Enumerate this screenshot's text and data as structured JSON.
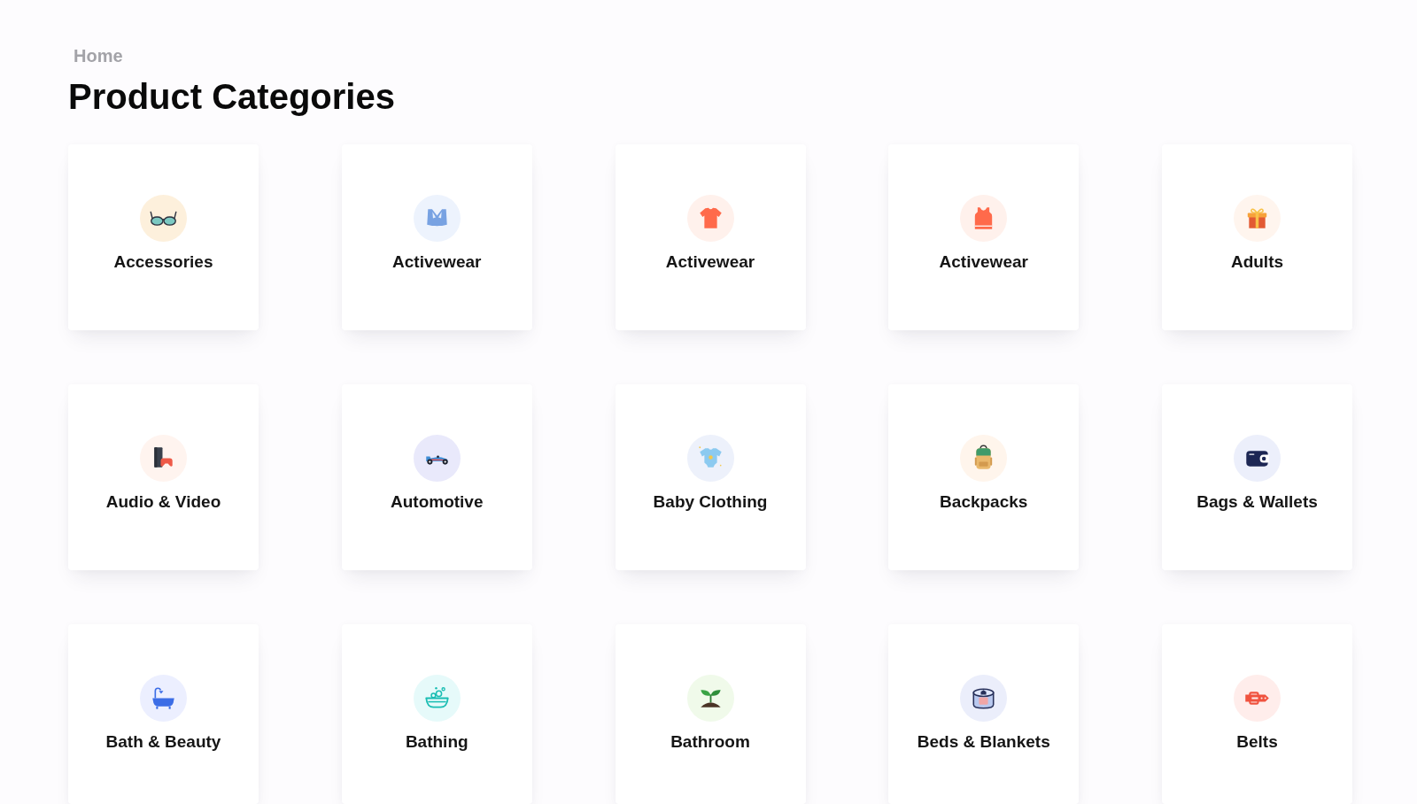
{
  "breadcrumb": {
    "label": "Home"
  },
  "title": "Product Categories",
  "categories": [
    {
      "label": "Accessories"
    },
    {
      "label": "Activewear"
    },
    {
      "label": "Activewear"
    },
    {
      "label": "Activewear"
    },
    {
      "label": "Adults"
    },
    {
      "label": "Audio & Video"
    },
    {
      "label": "Automotive"
    },
    {
      "label": "Baby Clothing"
    },
    {
      "label": "Backpacks"
    },
    {
      "label": "Bags & Wallets"
    },
    {
      "label": "Bath & Beauty"
    },
    {
      "label": "Bathing"
    },
    {
      "label": "Bathroom"
    },
    {
      "label": "Beds & Blankets"
    },
    {
      "label": "Belts"
    }
  ]
}
